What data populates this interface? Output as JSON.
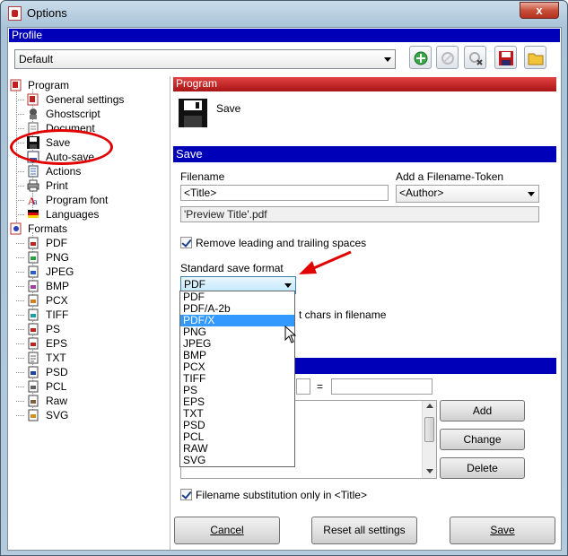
{
  "window": {
    "title": "Options",
    "close": "x"
  },
  "profile": {
    "header": "Profile",
    "selected": "Default"
  },
  "toolbar": {
    "icons": [
      "add-profile-icon",
      "rename-profile-icon",
      "delete-profile-icon",
      "save-profile-icon",
      "open-folder-icon"
    ]
  },
  "tree": {
    "program": "Program",
    "items": [
      "General settings",
      "Ghostscript",
      "Document",
      "Save",
      "Auto-save",
      "Actions",
      "Print",
      "Program font",
      "Languages"
    ],
    "formats": "Formats",
    "format_items": [
      "PDF",
      "PNG",
      "JPEG",
      "BMP",
      "PCX",
      "TIFF",
      "PS",
      "EPS",
      "TXT",
      "PSD",
      "PCL",
      "Raw",
      "SVG"
    ]
  },
  "program_section": {
    "header": "Program",
    "description": "Save"
  },
  "save_section": {
    "header": "Save",
    "filename_label": "Filename",
    "filename_value": "<Title>",
    "token_label": "Add a Filename-Token",
    "token_value": "<Author>",
    "preview": "'Preview Title'.pdf",
    "remove_spaces": "Remove leading and trailing spaces",
    "std_format_label": "Standard save format",
    "std_format_value": "PDF",
    "chars_partial": "t chars in filename",
    "equals": "=",
    "filename_subst_only": "Filename substitution only in <Title>"
  },
  "format_options": [
    "PDF",
    "PDF/A-2b",
    "PDF/X",
    "PNG",
    "JPEG",
    "BMP",
    "PCX",
    "TIFF",
    "PS",
    "EPS",
    "TXT",
    "PSD",
    "PCL",
    "RAW",
    "SVG"
  ],
  "selected_option_index": 2,
  "buttons": {
    "add": "Add",
    "change": "Change",
    "delete": "Delete",
    "cancel": "Cancel",
    "reset": "Reset all settings",
    "save": "Save"
  },
  "colors": {
    "section_blue": "#0000b8",
    "section_red": "#c02020",
    "highlight": "#3399ff",
    "annotation_red": "#e00000"
  }
}
